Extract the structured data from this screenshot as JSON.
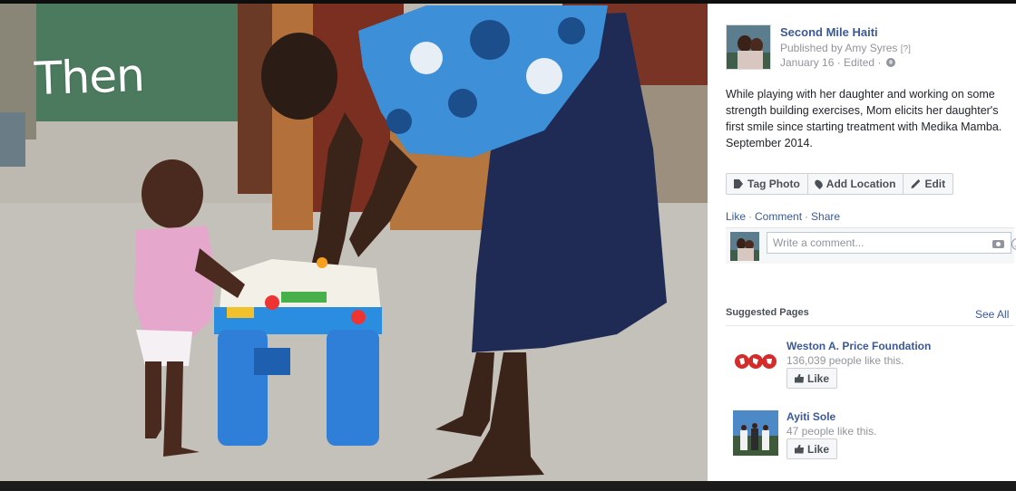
{
  "photo": {
    "overlay_text": "Then"
  },
  "post": {
    "page_name": "Second Mile Haiti",
    "published_by": "Published by Amy Syres",
    "help_mark": "[?]",
    "date": "January 16 · Edited ·",
    "caption": "While playing with her daughter and working on some strength building exercises, Mom elicits her daughter's first smile since starting treatment with Medika Mamba. September 2014."
  },
  "actions": {
    "tag_photo": "Tag Photo",
    "add_location": "Add Location",
    "edit": "Edit"
  },
  "social": {
    "like": "Like",
    "comment": "Comment",
    "share": "Share",
    "separator": "·"
  },
  "comment": {
    "placeholder": "Write a comment..."
  },
  "suggested": {
    "title": "Suggested Pages",
    "see_all": "See All",
    "pages": [
      {
        "name": "Weston A. Price Foundation",
        "likes": "136,039 people like this.",
        "button": "Like"
      },
      {
        "name": "Ayiti Sole",
        "likes": "47 people like this.",
        "button": "Like"
      }
    ]
  },
  "colors": {
    "link": "#3b5998",
    "muted": "#90949c",
    "text": "#1d2129"
  }
}
